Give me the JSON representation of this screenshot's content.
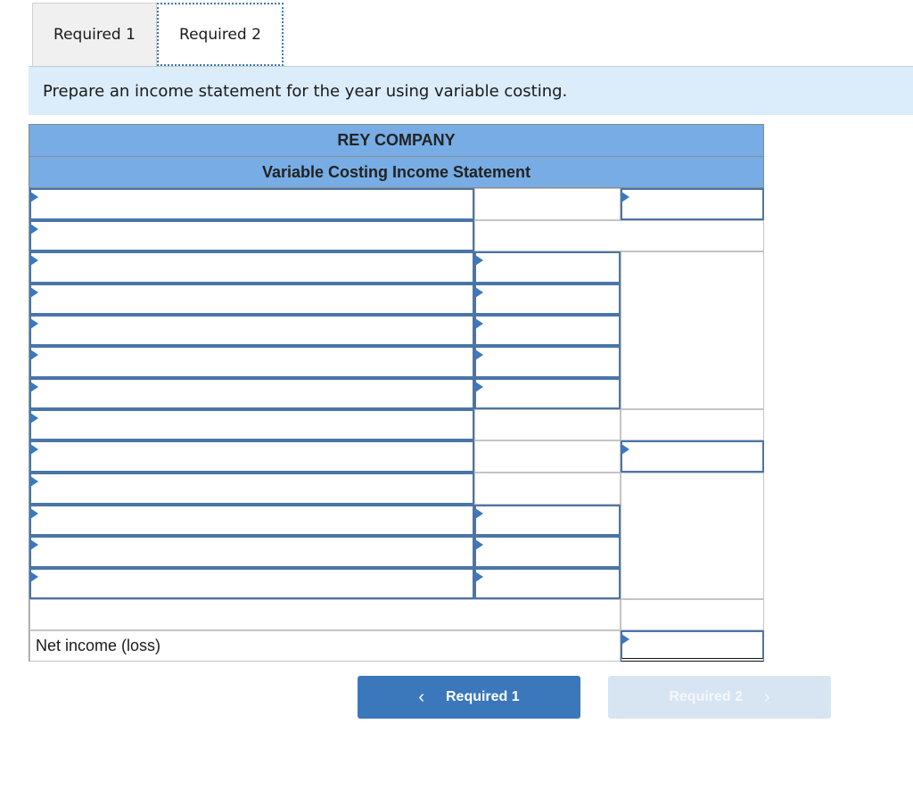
{
  "tabs": [
    {
      "label": "Required 1",
      "active": false
    },
    {
      "label": "Required 2",
      "active": true
    }
  ],
  "instruction": "Prepare an income statement for the year using variable costing.",
  "statement": {
    "company": "REY COMPANY",
    "title": "Variable Costing Income Statement",
    "net_income_label": "Net income (loss)",
    "inputs": {
      "r1_label": "",
      "r1_total": "",
      "r2_label": "",
      "r3_label": "",
      "r3_amount": "",
      "r4_label": "",
      "r4_amount": "",
      "r5_label": "",
      "r5_amount": "",
      "r6_label": "",
      "r6_amount": "",
      "r7_label": "",
      "r7_amount": "",
      "r8_label": "",
      "r9_label": "",
      "r9_total": "",
      "r10_label": "",
      "r11_label": "",
      "r11_amount": "",
      "r12_label": "",
      "r12_amount": "",
      "r13_label": "",
      "r13_amount": "",
      "net_income_value": ""
    }
  },
  "nav": {
    "prev_label": "Required 1",
    "next_label": "Required 2",
    "prev_icon": "chevron-left-icon",
    "next_icon": "chevron-right-icon"
  },
  "colors": {
    "header_blue": "#77ade4",
    "instruction_bg": "#dbecfa",
    "primary_button": "#3a77bb",
    "disabled_button": "#d7e4f2",
    "input_border": "#4a75a8"
  }
}
